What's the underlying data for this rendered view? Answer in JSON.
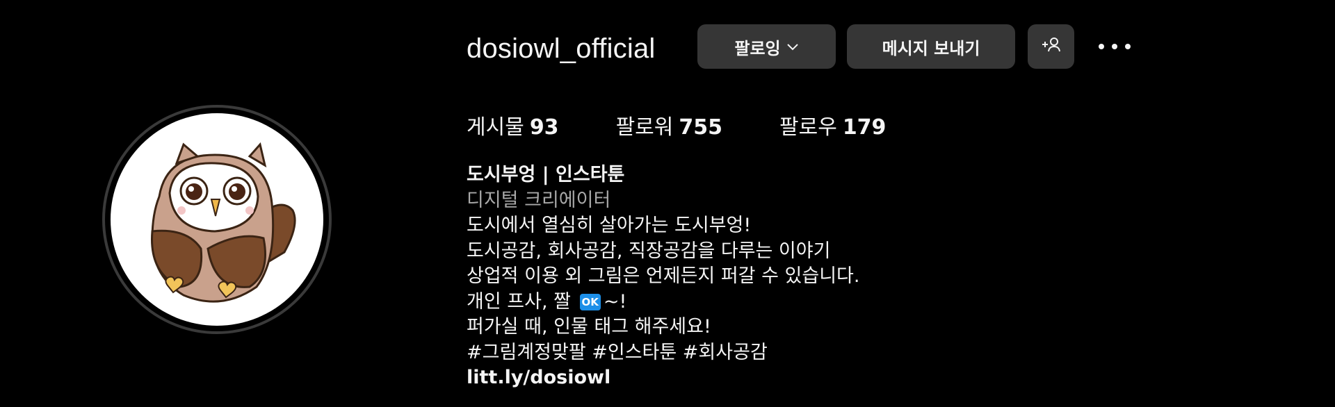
{
  "profile": {
    "username": "dosiowl_official",
    "avatar_icon": "owl-avatar-icon"
  },
  "actions": {
    "follow_label": "팔로잉",
    "message_label": "메시지 보내기",
    "add_user_icon": "add-user-icon",
    "more_icon": "more-dots-icon"
  },
  "stats": {
    "posts_label": "게시물",
    "posts_count": "93",
    "followers_label": "팔로워",
    "followers_count": "755",
    "following_label": "팔로우",
    "following_count": "179"
  },
  "bio": {
    "name": "도시부엉 | 인스타툰",
    "category": "디지털 크리에이터",
    "lines": [
      "도시에서 열심히 살아가는 도시부엉!",
      "도시공감, 회사공감, 직장공감을 다루는 이야기",
      "상업적 이용 외 그림은 언제든지 퍼갈 수 있습니다.",
      "개인 프사, 짤",
      "퍼가실 때, 인물 태그 해주세요!",
      "#그림계정맞팔 #인스타툰 #회사공감"
    ],
    "ok_badge": "OK",
    "line4_suffix": "~!",
    "link": "litt.ly/dosiowl"
  },
  "colors": {
    "background": "#000000",
    "button": "#363636",
    "text": "#f5f5f5",
    "muted": "#a8a8a8",
    "ok_badge": "#1d8fe8"
  }
}
